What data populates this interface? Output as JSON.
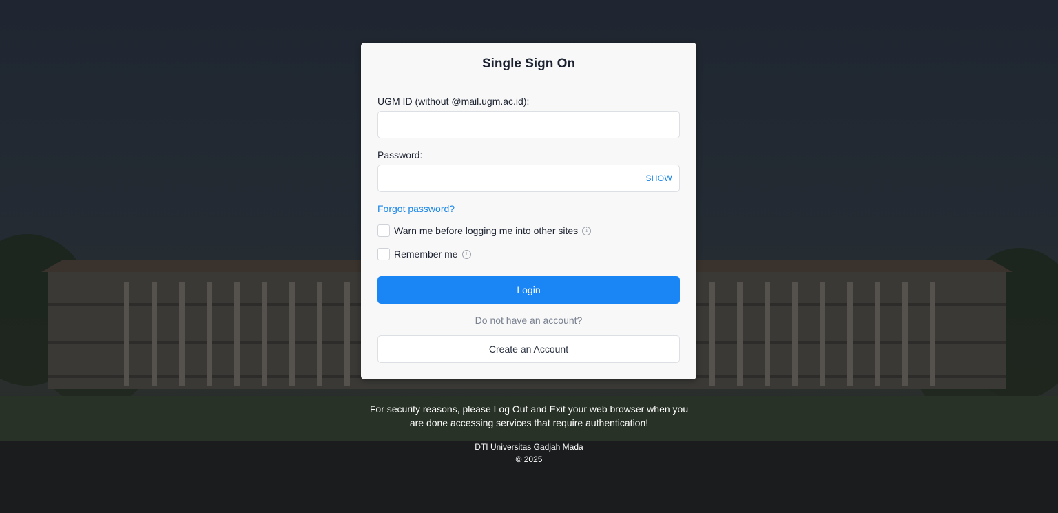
{
  "login_card": {
    "title": "Single Sign On",
    "username_label": "UGM ID (without @mail.ugm.ac.id):",
    "username_value": "",
    "password_label": "Password:",
    "password_value": "",
    "show_label": "SHOW",
    "forgot_label": "Forgot password?",
    "warn_label": "Warn me before logging me into other sites",
    "warn_checked": false,
    "remember_label": "Remember me",
    "remember_checked": false,
    "login_label": "Login",
    "no_account_text": "Do not have an account?",
    "create_label": "Create an Account"
  },
  "footer": {
    "security_line1": "For security reasons, please Log Out and Exit your web browser when you",
    "security_line2": "are done accessing services that require authentication!",
    "org": "DTI Universitas Gadjah Mada",
    "copyright": "© 2025"
  },
  "colors": {
    "accent": "#1a86f5",
    "link": "#1a86e8",
    "card_bg": "#f8f8f8"
  },
  "icons": {
    "info": "info-circle-icon"
  }
}
